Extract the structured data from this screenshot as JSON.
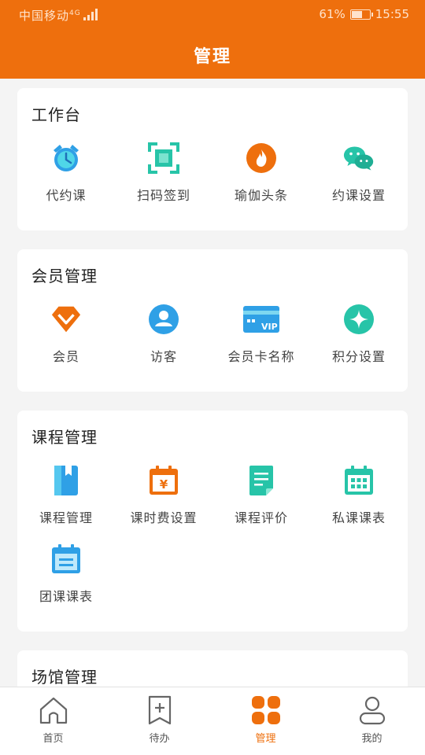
{
  "status": {
    "carrier": "中国移动",
    "network": "4G",
    "battery": "61%",
    "battery_level": 0.61,
    "time": "15:55"
  },
  "header": {
    "title": "管理"
  },
  "sections": [
    {
      "title": "工作台",
      "items": [
        {
          "label": "代约课",
          "icon": "alarm-clock-icon"
        },
        {
          "label": "扫码签到",
          "icon": "scan-icon"
        },
        {
          "label": "瑜伽头条",
          "icon": "flame-icon"
        },
        {
          "label": "约课设置",
          "icon": "wechat-icon"
        }
      ]
    },
    {
      "title": "会员管理",
      "items": [
        {
          "label": "会员",
          "icon": "diamond-icon"
        },
        {
          "label": "访客",
          "icon": "user-icon"
        },
        {
          "label": "会员卡名称",
          "icon": "vip-card-icon",
          "text": "VIP"
        },
        {
          "label": "积分设置",
          "icon": "star-points-icon"
        }
      ]
    },
    {
      "title": "课程管理",
      "items": [
        {
          "label": "课程管理",
          "icon": "book-icon"
        },
        {
          "label": "课时费设置",
          "icon": "fee-calendar-icon",
          "text": "¥"
        },
        {
          "label": "课程评价",
          "icon": "review-doc-icon"
        },
        {
          "label": "私课课表",
          "icon": "private-schedule-icon"
        },
        {
          "label": "团课课表",
          "icon": "group-schedule-icon"
        }
      ]
    },
    {
      "title": "场馆管理"
    }
  ],
  "tabbar": [
    {
      "label": "首页",
      "icon": "home-icon"
    },
    {
      "label": "待办",
      "icon": "todo-icon"
    },
    {
      "label": "管理",
      "icon": "manage-grid-icon",
      "active": true
    },
    {
      "label": "我的",
      "icon": "profile-icon"
    }
  ],
  "colors": {
    "brand": "#ee6f0d",
    "teal": "#27c4a8",
    "blue": "#2fa0e6"
  }
}
